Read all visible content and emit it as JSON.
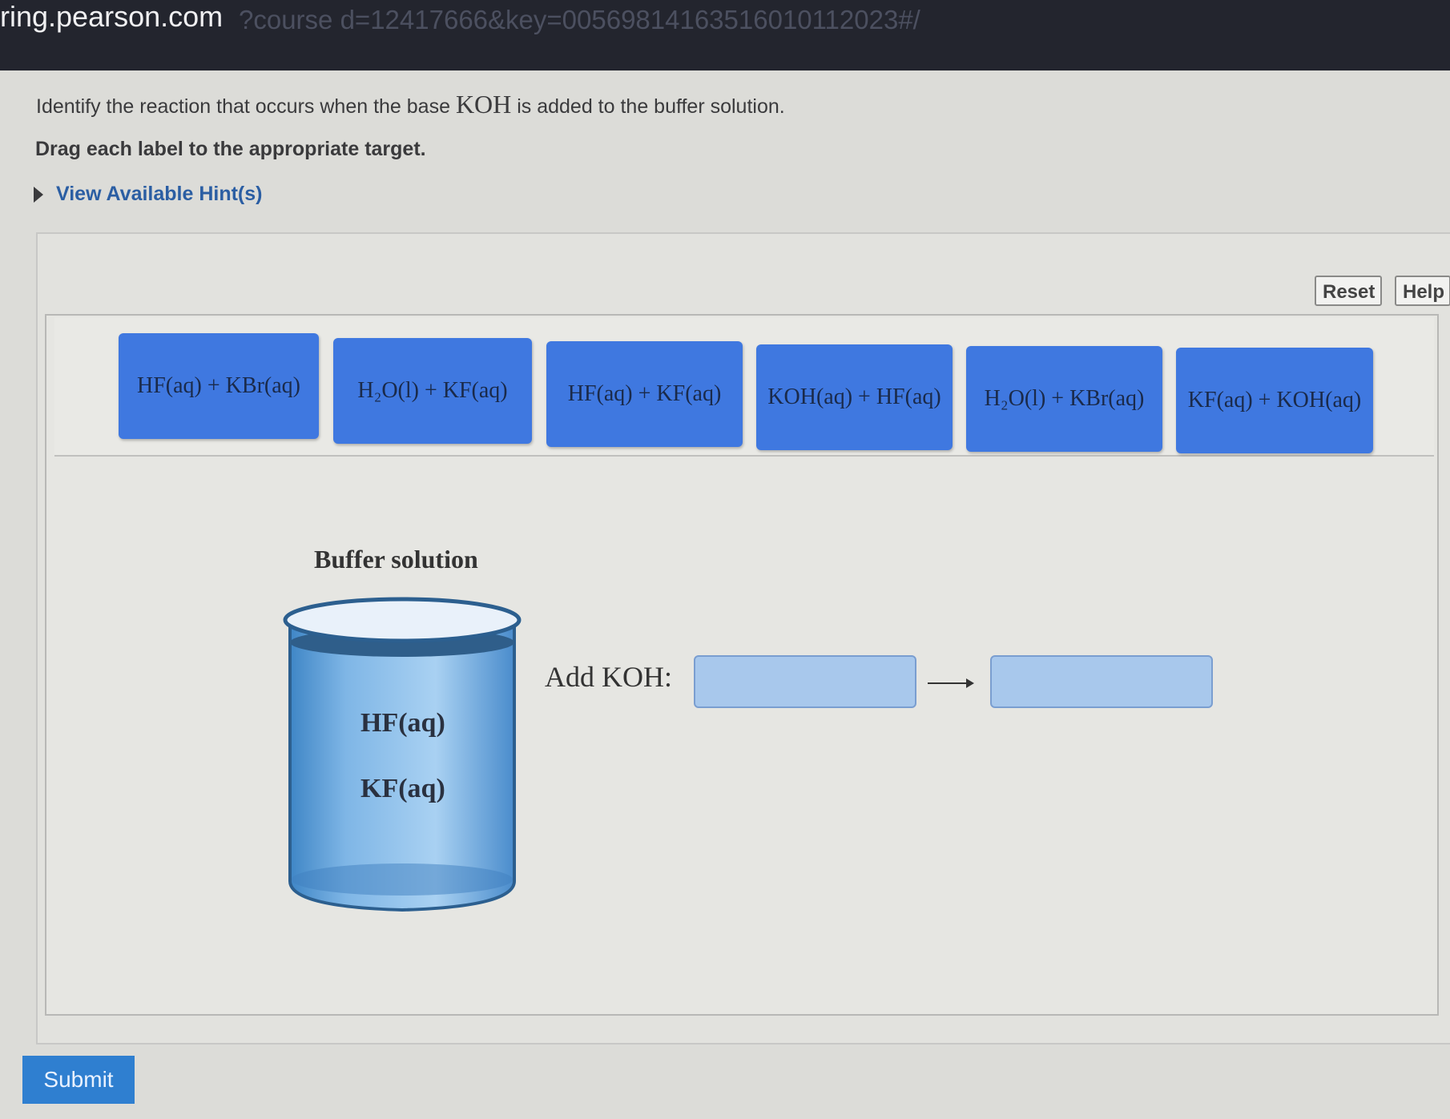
{
  "browser": {
    "host": "ring.pearson.com",
    "path": "?course d=12417666&key=005698141635160101120​23#/"
  },
  "question": {
    "text_before": "Identify the reaction that occurs when the base ",
    "formula": "KOH",
    "text_after": " is added to the buffer solution.",
    "instruction": "Drag each label to the appropriate target.",
    "hint_label": "View Available Hint(s)"
  },
  "toolbar": {
    "reset_label": "Reset",
    "help_label": "Help"
  },
  "labels": [
    "HF(aq) + KBr(aq)",
    "H₂O(l) + KF(aq)",
    "HF(aq) + KF(aq)",
    "KOH(aq) + HF(aq)",
    "H₂O(l) + KBr(aq)",
    "KF(aq) + KOH(aq)"
  ],
  "beaker": {
    "title": "Buffer solution",
    "contents": [
      "HF(aq)",
      "KF(aq)"
    ]
  },
  "reaction": {
    "prefix_label": "Add KOH:"
  },
  "submit_label": "Submit",
  "colors": {
    "chip": "#3f78e0",
    "drop_target": "#a8c8ec",
    "submit": "#2f7fd0",
    "hint": "#2b5ea3"
  }
}
